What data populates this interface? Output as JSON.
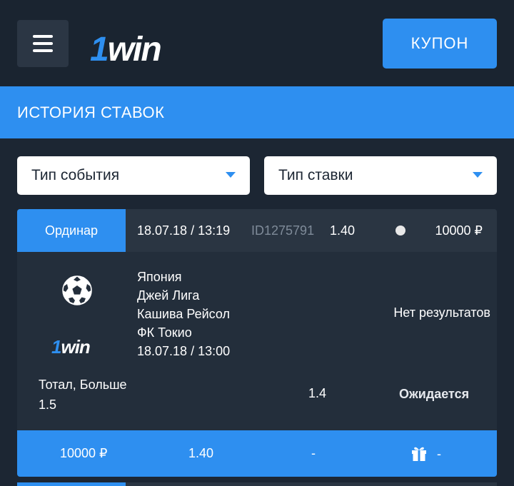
{
  "header": {
    "logo_one": "1",
    "logo_rest": "win",
    "coupon_label": "КУПОН",
    "menu_icon": "hamburger-menu-icon"
  },
  "page": {
    "title": "ИСТОРИЯ СТАВОК"
  },
  "filters": {
    "event_type": "Тип события",
    "bet_type": "Тип ставки"
  },
  "bet": {
    "type": "Ординар",
    "date": "18.07.18 / 13:19",
    "id": "ID1275791",
    "coefficient": "1.40",
    "amount": "10000 ₽",
    "sport_icon": "soccer-ball-icon",
    "logo_one": "1",
    "logo_rest": "win",
    "event": {
      "country": "Япония",
      "league": "Джей Лига",
      "team_home": "Кашива Рейсол",
      "team_away": "ФК Токио",
      "start": "18.07.18 / 13:00"
    },
    "result": "Нет результатов",
    "market": "Тотал, Больше 1.5",
    "market_coef": "1.4",
    "status": "Ожидается",
    "footer": {
      "amount": "10000 ₽",
      "coefficient": "1.40",
      "win": "-",
      "bonus_icon": "gift-icon",
      "bonus": "-"
    }
  },
  "colors": {
    "accent": "#2e8ff0",
    "background": "#1c2633",
    "card": "#232e3b"
  }
}
